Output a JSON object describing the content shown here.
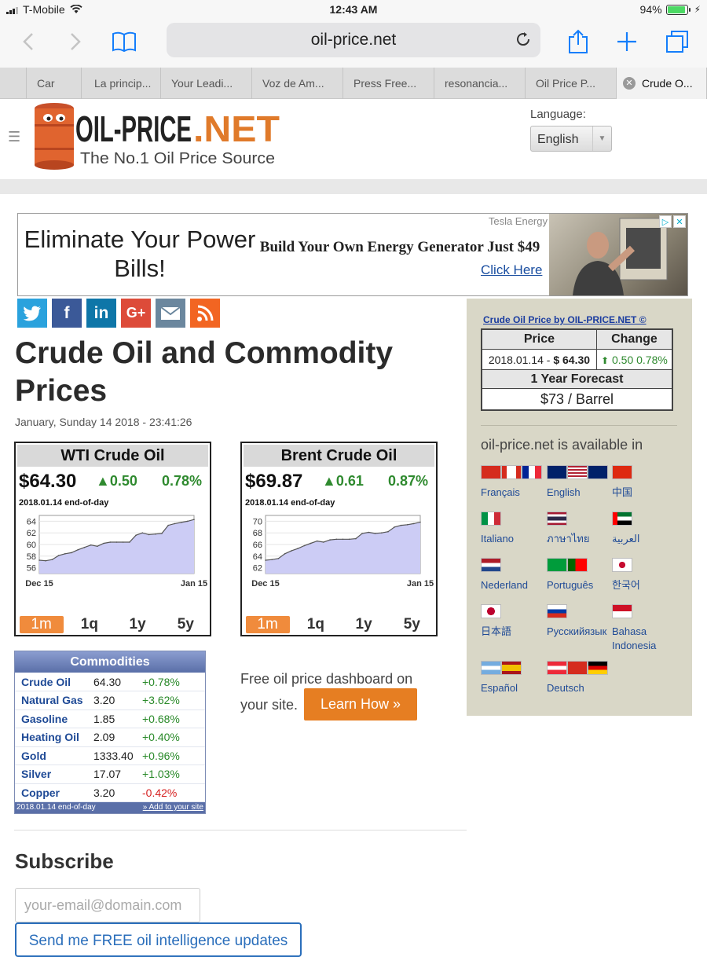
{
  "status_bar": {
    "carrier": "T-Mobile",
    "time": "12:43 AM",
    "battery": "94%"
  },
  "browser": {
    "url": "oil-price.net",
    "tabs": [
      {
        "label": "Car"
      },
      {
        "label": "La princip..."
      },
      {
        "label": "Your Leadi..."
      },
      {
        "label": "Voz de Am..."
      },
      {
        "label": "Press Free..."
      },
      {
        "label": "resonancia..."
      },
      {
        "label": "Oil Price P..."
      },
      {
        "label": "Crude O..."
      }
    ]
  },
  "header": {
    "logo_text": "OIL-PRICE.NET",
    "logo_tagline": "The No.1 Oil Price Source",
    "language_label": "Language:",
    "language_value": "English"
  },
  "ad": {
    "headline": "Eliminate Your Power Bills!",
    "sponsor": "Tesla Energy",
    "middle_text": "Build Your Own Energy Generator Just $49",
    "cta": "Click Here"
  },
  "social_icons": [
    "twitter-icon",
    "facebook-icon",
    "linkedin-icon",
    "google-plus-icon",
    "email-icon",
    "rss-icon"
  ],
  "page": {
    "title": "Crude Oil and Commodity Prices",
    "date": "January, Sunday 14 2018 - 23:41:26"
  },
  "wti": {
    "title": "WTI Crude Oil",
    "price": "$64.30",
    "change": "▲0.50",
    "percent": "0.78%",
    "eod": "2018.01.14 end-of-day",
    "ranges": [
      "1m",
      "1q",
      "1y",
      "5y"
    ],
    "selected_range": "1m",
    "x_labels": [
      "Dec 15",
      "Jan 15"
    ],
    "y_labels": [
      "64",
      "62",
      "60",
      "58",
      "56"
    ]
  },
  "brent": {
    "title": "Brent Crude Oil",
    "price": "$69.87",
    "change": "▲0.61",
    "percent": "0.87%",
    "eod": "2018.01.14 end-of-day",
    "ranges": [
      "1m",
      "1q",
      "1y",
      "5y"
    ],
    "selected_range": "1m",
    "x_labels": [
      "Dec 15",
      "Jan 15"
    ],
    "y_labels": [
      "70",
      "68",
      "66",
      "64",
      "62"
    ]
  },
  "chart_data": [
    {
      "type": "area",
      "title": "WTI Crude Oil",
      "xlabel": "",
      "ylabel": "",
      "x_ticks": [
        "Dec 15",
        "Jan 15"
      ],
      "ylim": [
        55,
        65
      ],
      "series": [
        {
          "values": [
            57.3,
            57.2,
            57.4,
            58.1,
            58.4,
            58.6,
            59.1,
            59.5,
            59.9,
            59.7,
            60.2,
            60.4,
            60.4,
            60.4,
            60.4,
            61.6,
            62.0,
            61.7,
            61.8,
            61.9,
            63.3,
            63.6,
            63.8,
            64.0,
            64.3
          ]
        }
      ]
    },
    {
      "type": "area",
      "title": "Brent Crude Oil",
      "xlabel": "",
      "ylabel": "",
      "x_ticks": [
        "Dec 15",
        "Jan 15"
      ],
      "ylim": [
        61,
        71
      ],
      "series": [
        {
          "values": [
            63.3,
            63.4,
            63.6,
            64.4,
            64.9,
            65.3,
            65.8,
            66.2,
            66.6,
            66.4,
            66.8,
            66.9,
            66.9,
            66.9,
            67.0,
            67.9,
            68.1,
            67.9,
            68.0,
            68.2,
            69.0,
            69.3,
            69.4,
            69.6,
            69.87
          ]
        }
      ]
    }
  ],
  "commodities": {
    "title": "Commodities",
    "rows": [
      {
        "name": "Crude Oil",
        "value": "64.30",
        "change": "+0.78%",
        "dir": "pos"
      },
      {
        "name": "Natural Gas",
        "value": "3.20",
        "change": "+3.62%",
        "dir": "pos"
      },
      {
        "name": "Gasoline",
        "value": "1.85",
        "change": "+0.68%",
        "dir": "pos"
      },
      {
        "name": "Heating Oil",
        "value": "2.09",
        "change": "+0.40%",
        "dir": "pos"
      },
      {
        "name": "Gold",
        "value": "1333.40",
        "change": "+0.96%",
        "dir": "pos"
      },
      {
        "name": "Silver",
        "value": "17.07",
        "change": "+1.03%",
        "dir": "pos"
      },
      {
        "name": "Copper",
        "value": "3.20",
        "change": "-0.42%",
        "dir": "neg"
      }
    ],
    "footer_date": "2018.01.14 end-of-day",
    "footer_link": "» Add to your site"
  },
  "dashboard": {
    "text": "Free oil price dashboard on your site.",
    "button": "Learn How »"
  },
  "subscribe": {
    "heading": "Subscribe",
    "placeholder": "your-email@domain.com",
    "button": "Send me FREE oil intelligence updates"
  },
  "sidebar": {
    "link": "Crude Oil Price by OIL-PRICE.NET ©",
    "col_price": "Price",
    "col_change": "Change",
    "price_value": "2018.01.14 - $ 64.30",
    "change_value": "0.50 0.78%",
    "forecast_label": "1 Year Forecast",
    "forecast_value": "$73 / Barrel",
    "available_in": "oil-price.net is available in",
    "languages": [
      {
        "label": "Français",
        "flags": [
          "ch",
          "ca",
          "fr"
        ]
      },
      {
        "label": "English",
        "flags": [
          "au",
          "us",
          "gb"
        ]
      },
      {
        "label": "中国",
        "flags": [
          "cn"
        ]
      },
      {
        "label": "Italiano",
        "flags": [
          "it"
        ]
      },
      {
        "label": "ภาษาไทย",
        "flags": [
          "th"
        ]
      },
      {
        "label": "العربية",
        "flags": [
          "ae"
        ]
      },
      {
        "label": "Nederland",
        "flags": [
          "nl"
        ]
      },
      {
        "label": "Português",
        "flags": [
          "br",
          "pt"
        ]
      },
      {
        "label": "한국어",
        "flags": [
          "kr"
        ]
      },
      {
        "label": "日本語",
        "flags": [
          "jp"
        ]
      },
      {
        "label": "Русскийязык",
        "flags": [
          "ru"
        ]
      },
      {
        "label": "Bahasa Indonesia",
        "flags": [
          "id"
        ]
      },
      {
        "label": "Español",
        "flags": [
          "ar",
          "es"
        ]
      },
      {
        "label": "Deutsch",
        "flags": [
          "at",
          "ch",
          "de"
        ]
      }
    ]
  },
  "colors": {
    "accent_blue": "#157efb",
    "brand_orange": "#e67e22",
    "up_green": "#2f8a2f",
    "down_red": "#d62020",
    "commodity_header": "#5a6fa8",
    "sidebar_bg": "#d9d7c7"
  }
}
